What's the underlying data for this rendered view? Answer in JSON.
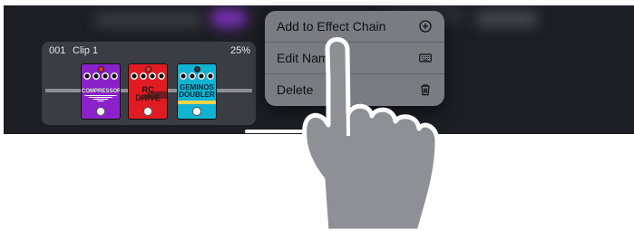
{
  "clip": {
    "number": "001",
    "name": "Clip 1",
    "percent": "25%",
    "pedals": [
      {
        "name": "COMPRESSOR",
        "color": "#8b22c9",
        "icon": "compressor-pedal"
      },
      {
        "name": "RC DRIVE",
        "color": "#e01b22",
        "icon": "rc-drive-pedal"
      },
      {
        "name": "GEMINOS DOUBLER",
        "color": "#12b2d2",
        "icon": "geminos-doubler-pedal"
      }
    ]
  },
  "context_menu": {
    "items": [
      {
        "label": "Add to Effect Chain",
        "icon": "add-circle-icon"
      },
      {
        "label": "Edit Name",
        "icon": "keyboard-icon"
      },
      {
        "label": "Delete",
        "icon": "trash-icon"
      }
    ]
  },
  "overlay": {
    "icon": "pointing-hand-icon"
  },
  "colors": {
    "screen_bg": "#1d1e24",
    "card_bg": "#3b3d44",
    "menu_bg": "#7a7c82",
    "hand": "#8f9095"
  }
}
